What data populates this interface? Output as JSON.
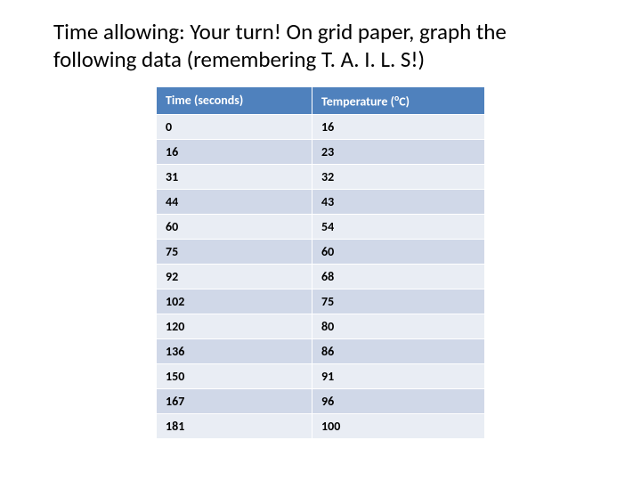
{
  "heading": "Time allowing: Your turn! On grid paper, graph the following data (remembering T. A. I. L. S!)",
  "table": {
    "headers": {
      "time": "Time (seconds)",
      "temp_prefix": "Temperature (",
      "temp_sup": "o",
      "temp_suffix": "C)"
    },
    "rows": [
      {
        "time": "0",
        "temp": "16"
      },
      {
        "time": "16",
        "temp": "23"
      },
      {
        "time": "31",
        "temp": "32"
      },
      {
        "time": "44",
        "temp": "43"
      },
      {
        "time": "60",
        "temp": "54"
      },
      {
        "time": "75",
        "temp": "60"
      },
      {
        "time": "92",
        "temp": "68"
      },
      {
        "time": "102",
        "temp": "75"
      },
      {
        "time": "120",
        "temp": "80"
      },
      {
        "time": "136",
        "temp": "86"
      },
      {
        "time": "150",
        "temp": "91"
      },
      {
        "time": "167",
        "temp": "96"
      },
      {
        "time": "181",
        "temp": "100"
      }
    ]
  },
  "chart_data": {
    "type": "table",
    "title": "Time vs Temperature data for graphing exercise",
    "columns": [
      "Time (seconds)",
      "Temperature (°C)"
    ],
    "x": [
      0,
      16,
      31,
      44,
      60,
      75,
      92,
      102,
      120,
      136,
      150,
      167,
      181
    ],
    "y": [
      16,
      23,
      32,
      43,
      54,
      60,
      68,
      75,
      80,
      86,
      91,
      96,
      100
    ],
    "xlabel": "Time (seconds)",
    "ylabel": "Temperature (°C)"
  }
}
